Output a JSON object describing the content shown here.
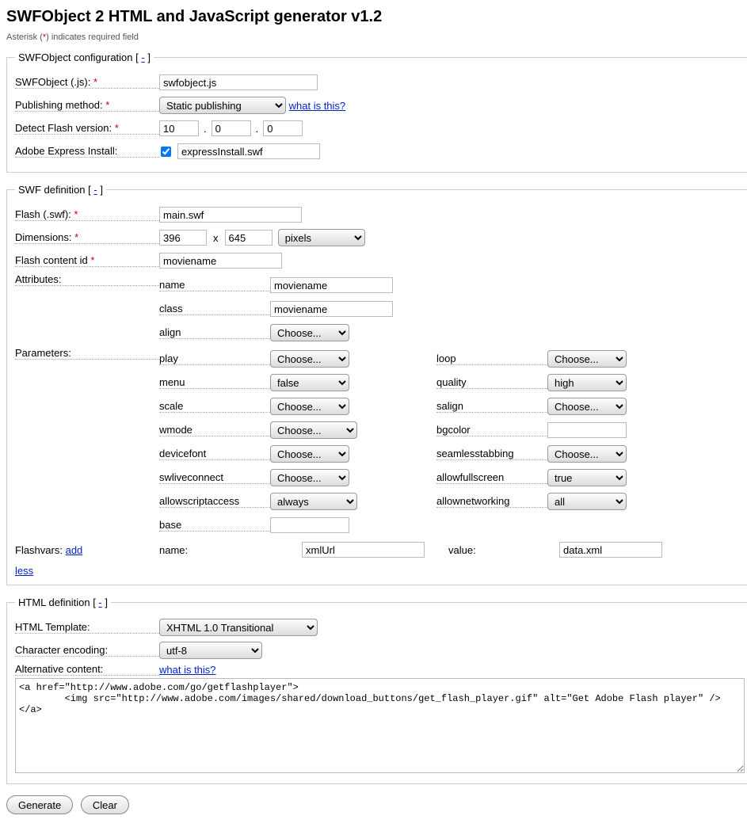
{
  "title": "SWFObject 2 HTML and JavaScript generator v1.2",
  "note_prefix": "Asterisk (",
  "note_star": "*",
  "note_suffix": ") indicates required field",
  "fs1": {
    "legend": "SWFObject configuration",
    "collapse": "-",
    "swfobject_label": "SWFObject (.js):",
    "swfobject_value": "swfobject.js",
    "pubmethod_label": "Publishing method:",
    "pubmethod_value": "Static publishing",
    "pubmethod_whatis": "what is this?",
    "detect_label": "Detect Flash version:",
    "detect_major": "10",
    "detect_minor": "0",
    "detect_rev": "0",
    "express_label": "Adobe Express Install:",
    "express_checked": true,
    "express_value": "expressInstall.swf"
  },
  "fs2": {
    "legend": "SWF definition",
    "collapse": "-",
    "flash_label": "Flash (.swf):",
    "flash_value": "main.swf",
    "dim_label": "Dimensions:",
    "dim_w": "396",
    "dim_h": "645",
    "dim_x": "x",
    "dim_unit": "pixels",
    "contentid_label": "Flash content id",
    "contentid_value": "moviename",
    "attr_label": "Attributes:",
    "attrs": [
      {
        "name": "name",
        "value": "moviename",
        "type": "text"
      },
      {
        "name": "class",
        "value": "moviename",
        "type": "text"
      },
      {
        "name": "align",
        "value": "Choose...",
        "type": "select"
      }
    ],
    "params_label": "Parameters:",
    "params": [
      [
        "play",
        "Choose...",
        "select",
        "loop",
        "Choose...",
        "select"
      ],
      [
        "menu",
        "false",
        "select",
        "quality",
        "high",
        "select"
      ],
      [
        "scale",
        "Choose...",
        "select",
        "salign",
        "Choose...",
        "select"
      ],
      [
        "wmode",
        "Choose...",
        "select-w",
        "bgcolor",
        "",
        "text"
      ],
      [
        "devicefont",
        "Choose...",
        "select",
        "seamlesstabbing",
        "Choose...",
        "select"
      ],
      [
        "swliveconnect",
        "Choose...",
        "select",
        "allowfullscreen",
        "true",
        "select"
      ],
      [
        "allowscriptaccess",
        "always",
        "select-w",
        "allownetworking",
        "all",
        "select"
      ],
      [
        "base",
        "",
        "text",
        "",
        "",
        "none"
      ]
    ],
    "flashvars_label": "Flashvars:",
    "flashvars_add": "add",
    "fv_name_label": "name:",
    "fv_name_value": "xmlUrl",
    "fv_value_label": "value:",
    "fv_value_value": "data.xml",
    "less": "less"
  },
  "fs3": {
    "legend": "HTML definition",
    "collapse": "-",
    "template_label": "HTML Template:",
    "template_value": "XHTML 1.0 Transitional",
    "encoding_label": "Character encoding:",
    "encoding_value": "utf-8",
    "alt_label": "Alternative content:",
    "alt_whatis": "what is this?",
    "alt_content": "<a href=\"http://www.adobe.com/go/getflashplayer\">\n        <img src=\"http://www.adobe.com/images/shared/download_buttons/get_flash_player.gif\" alt=\"Get Adobe Flash player\" />\n</a>"
  },
  "buttons": {
    "generate": "Generate",
    "clear": "Clear"
  },
  "dot": ".",
  "asterisk": "*"
}
